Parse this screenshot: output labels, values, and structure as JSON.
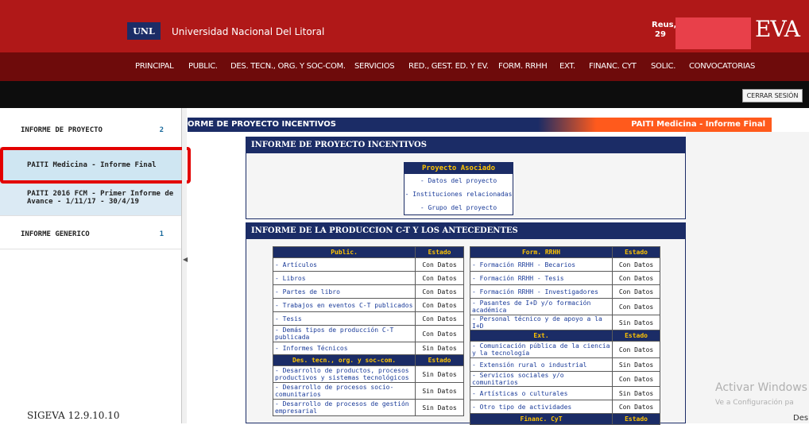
{
  "header": {
    "logo_text": "UNL",
    "university_name": "Universidad Nacional Del Litoral",
    "user_line1": "Reus,",
    "user_line2": "29",
    "brand_text": "EVA"
  },
  "nav": {
    "items": [
      "PRINCIPAL",
      "PUBLIC.",
      "DES. TECN., ORG. Y SOC-COM.",
      "SERVICIOS",
      "RED., GEST. ED. Y EV.",
      "FORM. RRHH",
      "EXT.",
      "FINANC. CYT",
      "SOLIC.",
      "CONVOCATORIAS"
    ]
  },
  "toolbar": {
    "logout_label": "CERRAR SESIÓN"
  },
  "sidebar": {
    "items": [
      {
        "label": "INFORME DE PROYECTO",
        "count": "2"
      },
      {
        "label": "PAITI Medicina - Informe Final",
        "count": ""
      },
      {
        "label": "PAITI 2016 FCM - Primer Informe de Avance - 1/11/17 - 30/4/19",
        "count": ""
      },
      {
        "label": "INFORME GENERICO",
        "count": "1"
      }
    ],
    "version": "SIGEVA 12.9.10.10"
  },
  "title_bar": {
    "left": "ORME DE PROYECTO INCENTIVOS",
    "right": "PAITI Medicina - Informe Final"
  },
  "panel1": {
    "title": "INFORME DE PROYECTO INCENTIVOS",
    "proj_header": "Proyecto Asociado",
    "links": [
      "- Datos del proyecto",
      "- Instituciones relacionadas",
      "- Grupo del proyecto"
    ]
  },
  "panel2": {
    "title": "INFORME DE LA PRODUCCION C-T Y LOS ANTECEDENTES"
  },
  "left_table": {
    "h1": "Public.",
    "h2": "Estado",
    "rows": [
      {
        "name": "- Artículos",
        "status": "Con Datos"
      },
      {
        "name": "- Libros",
        "status": "Con Datos"
      },
      {
        "name": "- Partes de libro",
        "status": "Con Datos"
      },
      {
        "name": "- Trabajos en eventos C-T publicados",
        "status": "Con Datos"
      },
      {
        "name": "- Tesis",
        "status": "Con Datos"
      },
      {
        "name": "- Demás tipos de producción C-T publicada",
        "status": "Con Datos"
      },
      {
        "name": "- Informes Técnicos",
        "status": "Sin Datos"
      }
    ],
    "h3": "Des. tecn., org. y soc-com.",
    "h4": "Estado",
    "rows2": [
      {
        "name": "- Desarrollo de productos, procesos productivos y sistemas tecnológicos",
        "status": "Sin Datos"
      },
      {
        "name": "- Desarrollo de procesos socio-comunitarios",
        "status": "Sin Datos"
      },
      {
        "name": "- Desarrollo de procesos de gestión empresarial",
        "status": "Sin Datos"
      }
    ]
  },
  "right_table": {
    "h1": "Form. RRHH",
    "h2": "Estado",
    "rows": [
      {
        "name": "- Formación RRHH - Becarios",
        "status": "Con Datos"
      },
      {
        "name": "- Formación RRHH - Tesis",
        "status": "Con Datos"
      },
      {
        "name": "- Formación RRHH - Investigadores",
        "status": "Con Datos"
      },
      {
        "name": "- Pasantes de I+D y/o formación académica",
        "status": "Con Datos"
      },
      {
        "name": "- Personal técnico y de apoyo a la I+D",
        "status": "Sin Datos"
      }
    ],
    "h3": "Ext.",
    "h4": "Estado",
    "rows2": [
      {
        "name": "- Comunicación pública de la ciencia y la tecnología",
        "status": "Con Datos"
      },
      {
        "name": "- Extensión rural o industrial",
        "status": "Sin Datos"
      },
      {
        "name": "- Servicios sociales y/o comunitarios",
        "status": "Con Datos"
      },
      {
        "name": "- Artísticas o culturales",
        "status": "Sin Datos"
      },
      {
        "name": "- Otro tipo de actividades",
        "status": "Con Datos"
      }
    ],
    "h5": "Financ. CyT",
    "h6": "Estado"
  },
  "watermark": {
    "line1": "Activar Windows",
    "line2": "Ve a Configuración pa",
    "corner": "Des"
  }
}
